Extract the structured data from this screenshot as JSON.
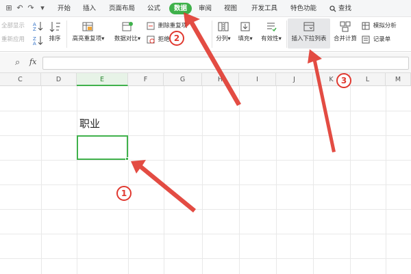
{
  "menu": {
    "quick_access": [
      "⊞",
      "↶",
      "↷",
      "▾"
    ],
    "tabs": [
      {
        "label": "开始"
      },
      {
        "label": "插入"
      },
      {
        "label": "页面布局"
      },
      {
        "label": "公式"
      },
      {
        "label": "数据",
        "active": true
      },
      {
        "label": "审阅"
      },
      {
        "label": "视图"
      },
      {
        "label": "开发工具"
      },
      {
        "label": "特色功能"
      }
    ],
    "search": "查找"
  },
  "ribbon": {
    "show_all": "全部显示",
    "reapply": "重新应用",
    "sort_label": "排序",
    "highlight_dup": "高亮重复项▾",
    "data_compare": "数据对比▾",
    "remove_dup": "删除重复项",
    "reject_dup": "拒绝",
    "split": "分列▾",
    "fill": "填充▾",
    "validity": "有效性▾",
    "insert_dropdown": "插入下拉列表",
    "consolidate": "合并计算",
    "simulate": "模拟分析",
    "record": "记录单"
  },
  "formula_bar": {
    "zoom_icon": "⌕",
    "fx": "fx",
    "value": ""
  },
  "columns": [
    "C",
    "D",
    "E",
    "F",
    "G",
    "H",
    "I",
    "J",
    "K",
    "L",
    "M"
  ],
  "selected_column": "E",
  "cells": {
    "label": "职业"
  },
  "annotations": {
    "badge1": "1",
    "badge2": "2",
    "badge3": "3"
  },
  "colors": {
    "accent": "#3fb14b",
    "annotation": "#e0382f"
  }
}
